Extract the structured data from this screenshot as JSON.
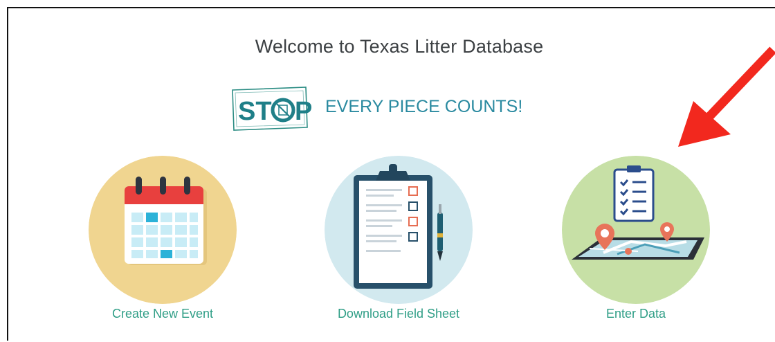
{
  "page": {
    "title": "Welcome to Texas Litter Database"
  },
  "logo": {
    "stop_text_start": "ST",
    "stop_text_end": "P",
    "slogan": "EVERY PIECE COUNTS!"
  },
  "cards": [
    {
      "label": "Create New Event",
      "icon": "calendar-icon",
      "circle_color": "#f0d590"
    },
    {
      "label": "Download Field Sheet",
      "icon": "clipboard-icon",
      "circle_color": "#d2e9ef"
    },
    {
      "label": "Enter Data",
      "icon": "map-checklist-icon",
      "circle_color": "#c7e0a6"
    }
  ],
  "colors": {
    "accent": "#2f9e86",
    "arrow": "#f2281e",
    "title": "#3c4043"
  }
}
